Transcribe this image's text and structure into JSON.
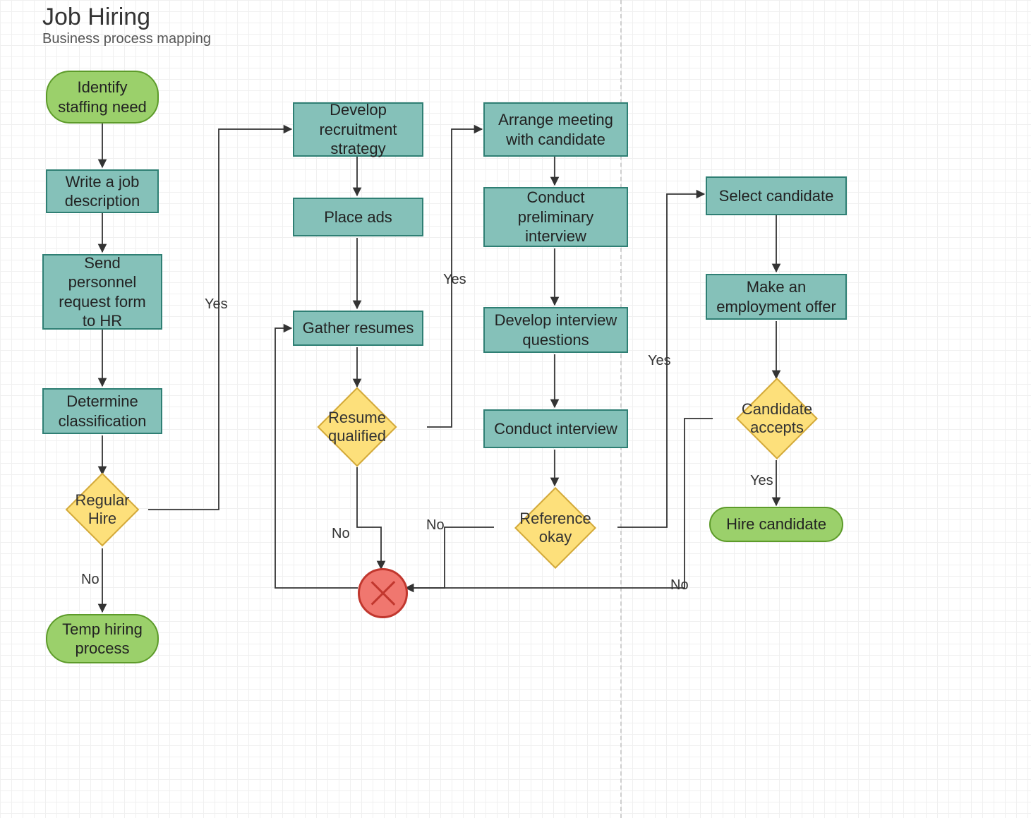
{
  "header": {
    "title": "Job Hiring",
    "subtitle": "Business process mapping"
  },
  "nodes": {
    "identify": "Identify staffing need",
    "write_job": "Write a job description",
    "send_hr": "Send personnel request form to HR",
    "determine": "Determine classification",
    "regular_hire": "Regular Hire",
    "temp": "Temp hiring process",
    "develop_strategy": "Develop recruitment strategy",
    "place_ads": "Place ads",
    "gather": "Gather resumes",
    "resume_qualified": "Resume qualified",
    "arrange": "Arrange meeting with candidate",
    "conduct_prelim": "Conduct preliminary interview",
    "develop_q": "Develop interview questions",
    "conduct_interview": "Conduct interview",
    "ref_ok": "Reference okay",
    "select": "Select candidate",
    "make_offer": "Make an employment offer",
    "cand_accepts": "Candidate accepts",
    "hire": "Hire candidate"
  },
  "labels": {
    "yes": "Yes",
    "no": "No"
  },
  "chart_data": {
    "type": "flowchart",
    "title": "Job Hiring",
    "subtitle": "Business process mapping",
    "nodes": [
      {
        "id": "identify",
        "type": "terminator",
        "label": "Identify staffing need"
      },
      {
        "id": "write_job",
        "type": "process",
        "label": "Write a job description"
      },
      {
        "id": "send_hr",
        "type": "process",
        "label": "Send personnel request form to HR"
      },
      {
        "id": "determine",
        "type": "process",
        "label": "Determine classification"
      },
      {
        "id": "regular_hire",
        "type": "decision",
        "label": "Regular Hire"
      },
      {
        "id": "temp",
        "type": "terminator",
        "label": "Temp hiring process"
      },
      {
        "id": "develop_strategy",
        "type": "process",
        "label": "Develop recruitment strategy"
      },
      {
        "id": "place_ads",
        "type": "process",
        "label": "Place ads"
      },
      {
        "id": "gather",
        "type": "process",
        "label": "Gather resumes"
      },
      {
        "id": "resume_qualified",
        "type": "decision",
        "label": "Resume qualified"
      },
      {
        "id": "stop",
        "type": "stop",
        "label": ""
      },
      {
        "id": "arrange",
        "type": "process",
        "label": "Arrange meeting with candidate"
      },
      {
        "id": "conduct_prelim",
        "type": "process",
        "label": "Conduct preliminary interview"
      },
      {
        "id": "develop_q",
        "type": "process",
        "label": "Develop interview questions"
      },
      {
        "id": "conduct_interview",
        "type": "process",
        "label": "Conduct interview"
      },
      {
        "id": "ref_ok",
        "type": "decision",
        "label": "Reference okay"
      },
      {
        "id": "select",
        "type": "process",
        "label": "Select candidate"
      },
      {
        "id": "make_offer",
        "type": "process",
        "label": "Make an employment offer"
      },
      {
        "id": "cand_accepts",
        "type": "decision",
        "label": "Candidate accepts"
      },
      {
        "id": "hire",
        "type": "terminator",
        "label": "Hire candidate"
      }
    ],
    "edges": [
      {
        "from": "identify",
        "to": "write_job"
      },
      {
        "from": "write_job",
        "to": "send_hr"
      },
      {
        "from": "send_hr",
        "to": "determine"
      },
      {
        "from": "determine",
        "to": "regular_hire"
      },
      {
        "from": "regular_hire",
        "to": "temp",
        "label": "No"
      },
      {
        "from": "regular_hire",
        "to": "develop_strategy",
        "label": "Yes"
      },
      {
        "from": "develop_strategy",
        "to": "place_ads"
      },
      {
        "from": "place_ads",
        "to": "gather"
      },
      {
        "from": "gather",
        "to": "resume_qualified"
      },
      {
        "from": "resume_qualified",
        "to": "arrange",
        "label": "Yes"
      },
      {
        "from": "resume_qualified",
        "to": "stop",
        "label": "No"
      },
      {
        "from": "arrange",
        "to": "conduct_prelim"
      },
      {
        "from": "conduct_prelim",
        "to": "develop_q"
      },
      {
        "from": "develop_q",
        "to": "conduct_interview"
      },
      {
        "from": "conduct_interview",
        "to": "ref_ok"
      },
      {
        "from": "ref_ok",
        "to": "select",
        "label": "Yes"
      },
      {
        "from": "ref_ok",
        "to": "stop",
        "label": "No"
      },
      {
        "from": "select",
        "to": "make_offer"
      },
      {
        "from": "make_offer",
        "to": "cand_accepts"
      },
      {
        "from": "cand_accepts",
        "to": "hire",
        "label": "Yes"
      },
      {
        "from": "cand_accepts",
        "to": "stop",
        "label": "No"
      },
      {
        "from": "stop",
        "to": "gather"
      }
    ]
  }
}
